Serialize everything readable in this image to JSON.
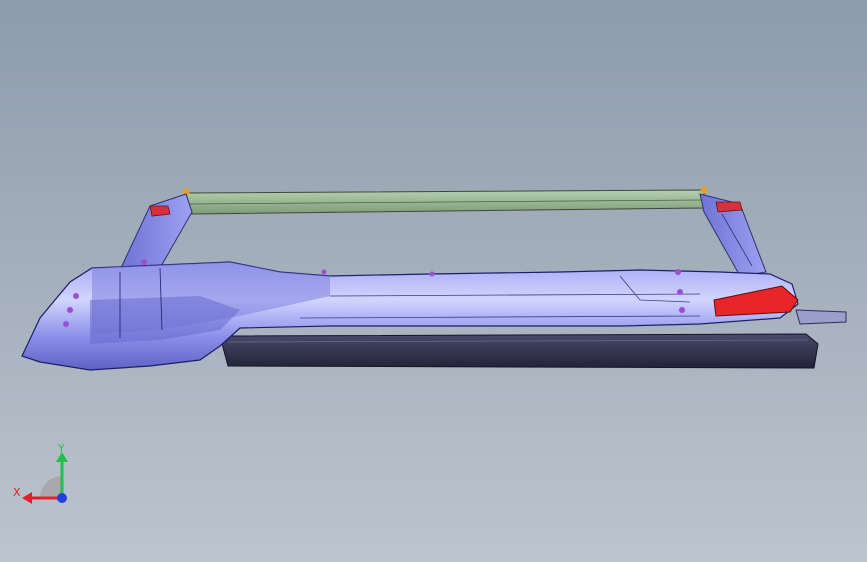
{
  "viewport": {
    "background_top": "#8d9bab",
    "background_bottom": "#bcc4ce"
  },
  "model": {
    "body_color": "#8b8ee8",
    "body_highlight": "#c9ccff",
    "rail_color": "#8fb08a",
    "base_color": "#2e2e4a",
    "accent_color": "#e8262a",
    "fastener_color": "#9a4fd6"
  },
  "triad": {
    "x_label": "X",
    "y_label": "Y",
    "x_color": "#e0202a",
    "y_color": "#22c04a",
    "z_color": "#2040e0"
  }
}
